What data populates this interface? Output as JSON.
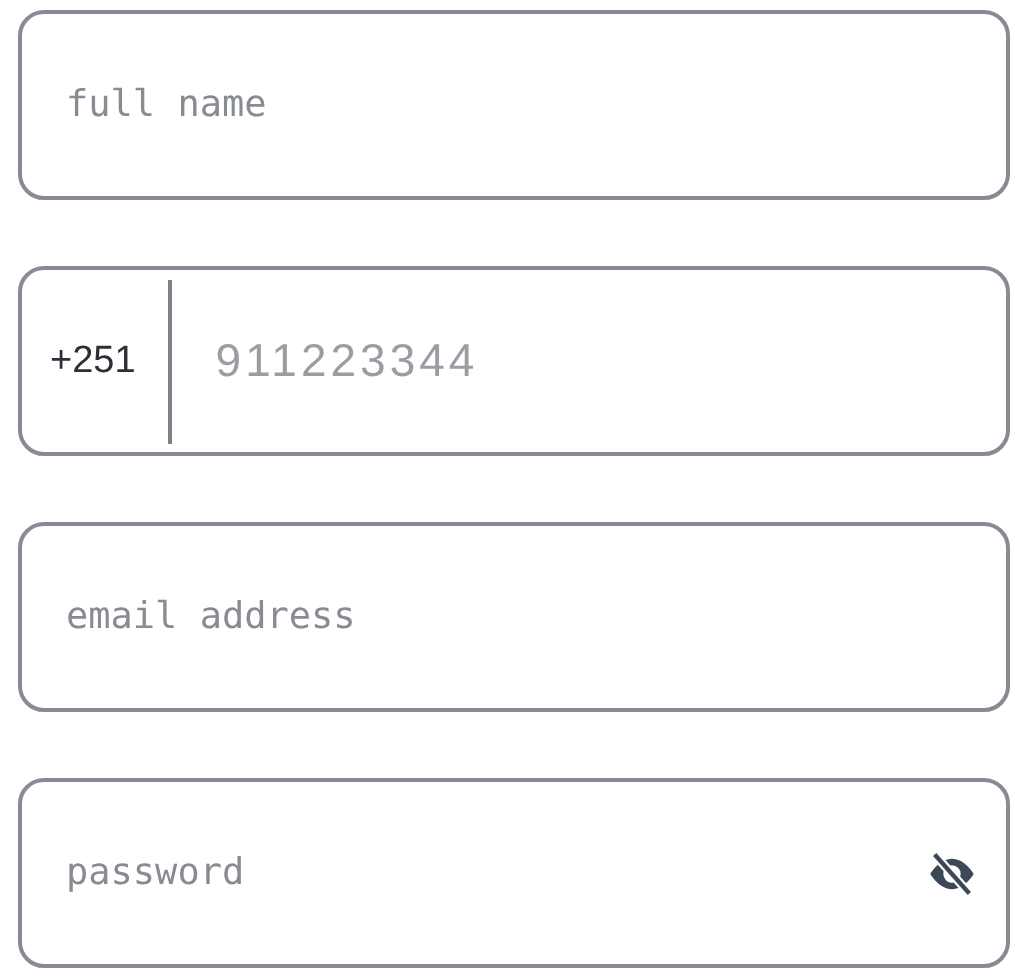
{
  "fields": [
    {
      "kind": "text",
      "placeholder": "full name"
    },
    {
      "kind": "phone",
      "prefix": "+251",
      "placeholder": "911223344"
    },
    {
      "kind": "text",
      "placeholder": "email address"
    },
    {
      "kind": "password",
      "placeholder": "password",
      "revealed": false
    }
  ]
}
